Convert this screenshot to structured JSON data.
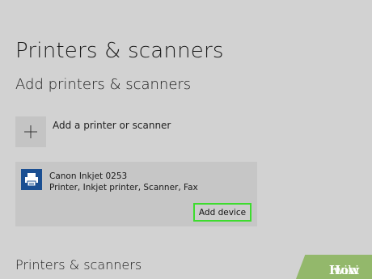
{
  "page": {
    "title": "Printers & scanners"
  },
  "add_section": {
    "title": "Add printers & scanners",
    "add_label": "Add a printer or scanner"
  },
  "device": {
    "name": "Canon Inkjet 0253",
    "description": "Printer, Inkjet printer, Scanner, Fax",
    "icon": "printer-icon",
    "add_button_label": "Add device"
  },
  "bottom_section": {
    "title": "Printers & scanners"
  },
  "watermark": {
    "wiki": "wiki",
    "how": "How"
  },
  "colors": {
    "background": "#d2d2d2",
    "device_icon_bg": "#1b4f92",
    "highlight_border": "#3ddc2e",
    "watermark_bg": "#93b86b"
  }
}
